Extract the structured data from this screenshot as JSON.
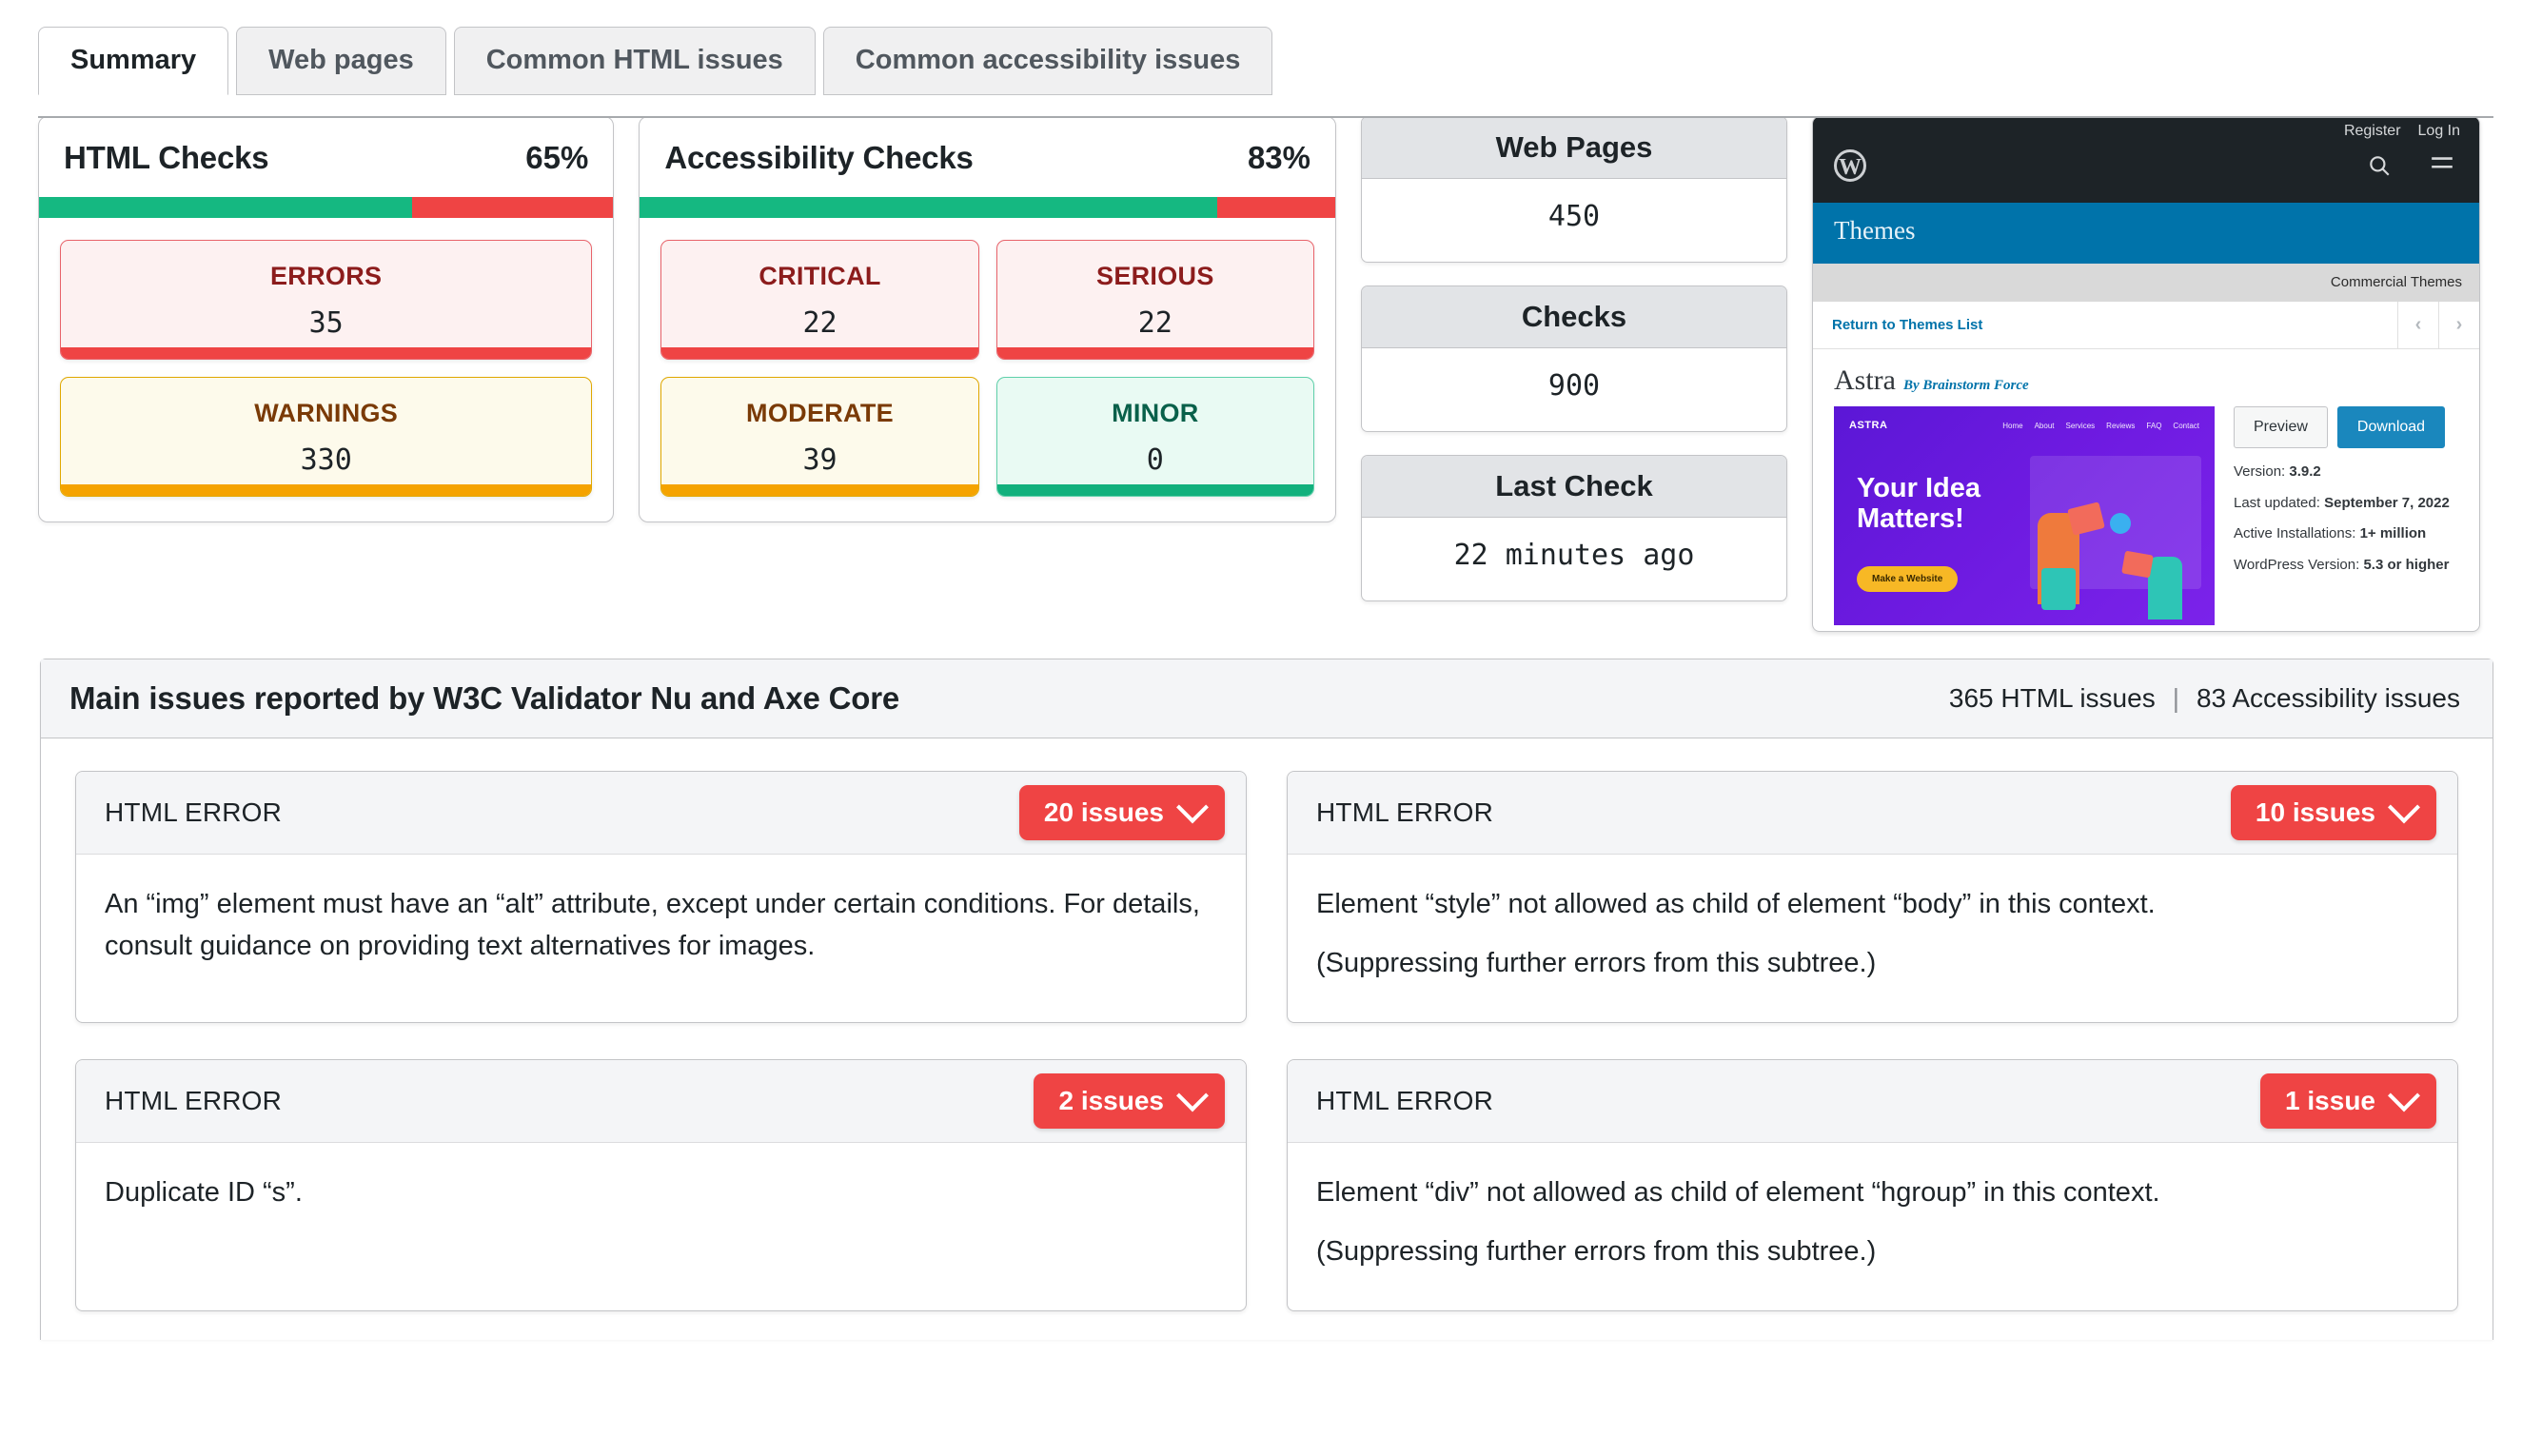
{
  "tabs": [
    {
      "label": "Summary",
      "active": true
    },
    {
      "label": "Web pages",
      "active": false
    },
    {
      "label": "Common HTML issues",
      "active": false
    },
    {
      "label": "Common accessibility issues",
      "active": false
    }
  ],
  "html_checks": {
    "title": "HTML Checks",
    "percent": "65%",
    "percent_value": 65,
    "metrics": [
      {
        "label": "ERRORS",
        "value": "35",
        "tone": "red"
      },
      {
        "label": "WARNINGS",
        "value": "330",
        "tone": "yellow"
      }
    ]
  },
  "accessibility_checks": {
    "title": "Accessibility Checks",
    "percent": "83%",
    "percent_value": 83,
    "metrics": [
      {
        "label": "CRITICAL",
        "value": "22",
        "tone": "red"
      },
      {
        "label": "SERIOUS",
        "value": "22",
        "tone": "red"
      },
      {
        "label": "MODERATE",
        "value": "39",
        "tone": "yellow"
      },
      {
        "label": "MINOR",
        "value": "0",
        "tone": "green"
      }
    ]
  },
  "stats": [
    {
      "label": "Web Pages",
      "value": "450"
    },
    {
      "label": "Checks",
      "value": "900"
    },
    {
      "label": "Last Check",
      "value": "22 minutes ago"
    }
  ],
  "wp_preview": {
    "register": "Register",
    "login": "Log In",
    "section": "Themes",
    "commercial": "Commercial Themes",
    "return_link": "Return to Themes List",
    "theme_name": "Astra",
    "theme_author": "By Brainstorm Force",
    "preview_button": "Preview",
    "download_button": "Download",
    "version_label": "Version:",
    "version_value": "3.9.2",
    "updated_label": "Last updated:",
    "updated_value": "September 7, 2022",
    "installs_label": "Active Installations:",
    "installs_value": "1+ million",
    "wpver_label": "WordPress Version:",
    "wpver_value": "5.3 or higher",
    "hero_brand": "ASTRA",
    "hero_nav": [
      "Home",
      "About",
      "Services",
      "Reviews",
      "FAQ",
      "Contact"
    ],
    "hero_line1": "Your Idea",
    "hero_line2": "Matters!",
    "hero_cta": "Make a Website"
  },
  "issues": {
    "title": "Main issues reported by W3C Validator Nu and Axe Core",
    "html_count": "365 HTML issues",
    "separator": "|",
    "a11y_count": "83 Accessibility issues",
    "cards": [
      {
        "kind": "HTML ERROR",
        "badge": "20 issues",
        "lines": [
          "An “img” element must have an “alt” attribute, except under certain conditions. For details, consult guidance on providing text alternatives for images."
        ]
      },
      {
        "kind": "HTML ERROR",
        "badge": "10 issues",
        "lines": [
          "Element “style” not allowed as child of element “body” in this context.",
          "(Suppressing further errors from this subtree.)"
        ]
      },
      {
        "kind": "HTML ERROR",
        "badge": "2 issues",
        "lines": [
          "Duplicate ID “s”."
        ]
      },
      {
        "kind": "HTML ERROR",
        "badge": "1 issue",
        "lines": [
          "Element “div” not allowed as child of element “hgroup” in this context.",
          "(Suppressing further errors from this subtree.)"
        ]
      }
    ]
  },
  "colors": {
    "accent_red": "#ef4444",
    "accent_green": "#15b881",
    "accent_yellow": "#f5a300",
    "wp_blue": "#0073aa"
  }
}
